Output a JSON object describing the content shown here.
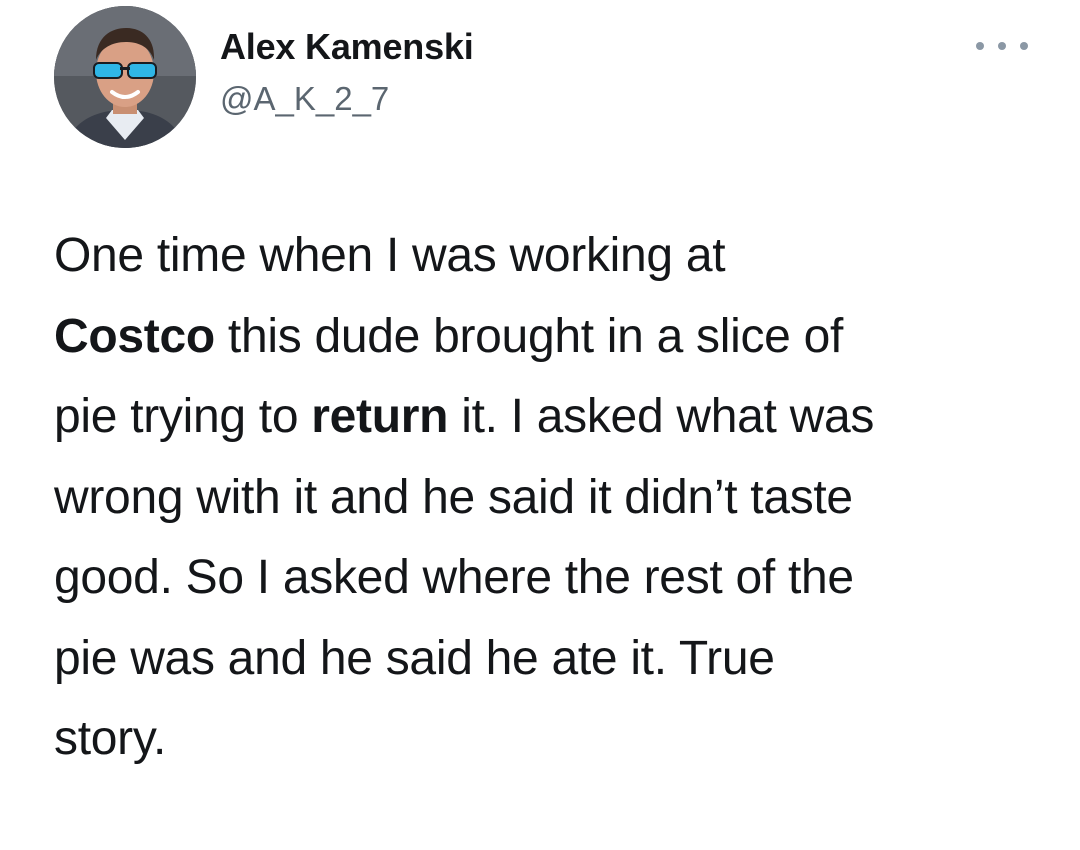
{
  "tweet": {
    "author": {
      "display_name": "Alex Kamenski",
      "handle": "@A_K_2_7",
      "avatar_icon": "profile-photo"
    },
    "more_icon": "more-options-icon",
    "body_lines": [
      {
        "parts": [
          {
            "text": "One time when I was working at",
            "bold": false
          }
        ]
      },
      {
        "parts": [
          {
            "text": "Costco",
            "bold": true
          },
          {
            "text": " this dude brought in a slice of",
            "bold": false
          }
        ]
      },
      {
        "parts": [
          {
            "text": "pie trying to ",
            "bold": false
          },
          {
            "text": "return",
            "bold": true
          },
          {
            "text": " it. I asked what was",
            "bold": false
          }
        ]
      },
      {
        "parts": [
          {
            "text": "wrong with it and he said it didn’t taste",
            "bold": false
          }
        ]
      },
      {
        "parts": [
          {
            "text": "good. So I asked where the rest of the",
            "bold": false
          }
        ]
      },
      {
        "parts": [
          {
            "text": "pie was and he said he ate it. True",
            "bold": false
          }
        ]
      },
      {
        "parts": [
          {
            "text": "story.",
            "bold": false
          }
        ]
      }
    ]
  },
  "colors": {
    "text_primary": "#141619",
    "text_secondary": "#5b6670",
    "icon_gray": "#8b98a5",
    "background": "#ffffff"
  }
}
